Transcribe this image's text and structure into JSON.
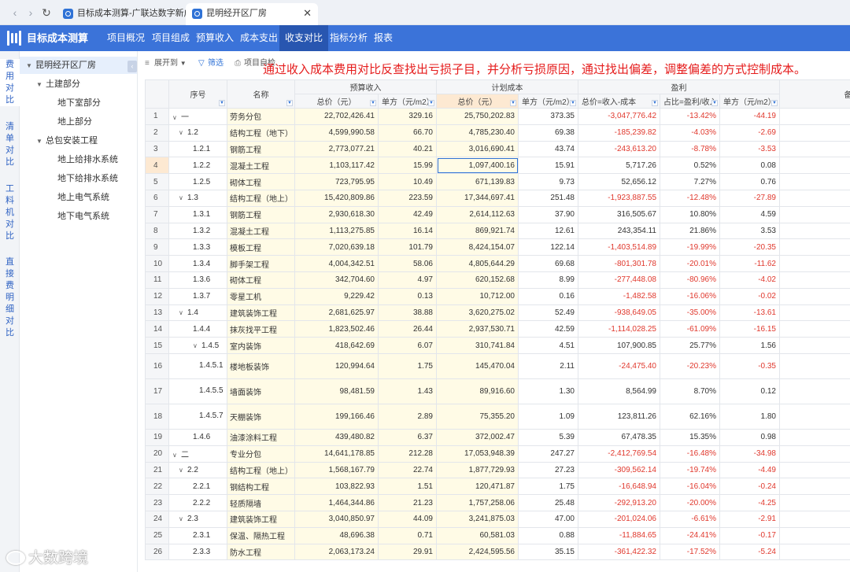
{
  "browser": {
    "tabs": [
      {
        "title": "目标成本测算-广联达数字新成本"
      },
      {
        "title": "昆明经开区厂房"
      }
    ]
  },
  "app": {
    "title": "目标成本测算",
    "menu": [
      "项目概况",
      "项目组成",
      "预算收入",
      "成本支出",
      "收支对比",
      "指标分析",
      "报表"
    ],
    "active_menu": "收支对比"
  },
  "side_tabs": [
    "费用对比",
    "清单对比",
    "工料机对比",
    "直接费明细对比"
  ],
  "tree": [
    {
      "label": "昆明经开区厂房",
      "level": 0,
      "caret": true
    },
    {
      "label": "土建部分",
      "level": 1,
      "caret": true
    },
    {
      "label": "地下室部分",
      "level": 2,
      "caret": false
    },
    {
      "label": "地上部分",
      "level": 2,
      "caret": false
    },
    {
      "label": "总包安装工程",
      "level": 1,
      "caret": true
    },
    {
      "label": "地上给排水系统",
      "level": 2,
      "caret": false
    },
    {
      "label": "地下给排水系统",
      "level": 2,
      "caret": false
    },
    {
      "label": "地上电气系统",
      "level": 2,
      "caret": false
    },
    {
      "label": "地下电气系统",
      "level": 2,
      "caret": false
    }
  ],
  "toolbar": {
    "expand": "展开到",
    "filter": "筛选",
    "check": "项目自检"
  },
  "annotation": "通过收入成本费用对比反查找出亏损子目，并分析亏损原因，通过找出偏差，调整偏差的方式控制成本。",
  "table": {
    "headers": {
      "seq": "序号",
      "name": "名称",
      "budget": "预算收入",
      "plan": "计划成本",
      "profit": "盈利",
      "note": "备注",
      "budget_total": "总价（元）",
      "budget_unit": "单方（元/m2）",
      "plan_total": "总价（元）",
      "plan_unit": "单方（元/m2）",
      "profit_total": "总价=收入-成本",
      "profit_ratio": "占比=盈利/收入",
      "profit_unit": "单方（元/m2）"
    },
    "rows": [
      {
        "idx": "1",
        "seq": "一",
        "caret": true,
        "indent": 0,
        "name": "劳务分包",
        "bt": "22,702,426.41",
        "bu": "329.16",
        "pt": "25,750,202.83",
        "pu": "373.35",
        "ft": "-3,047,776.42",
        "fr": "-13.42%",
        "fu": "-44.19"
      },
      {
        "idx": "2",
        "seq": "1.2",
        "caret": true,
        "indent": 1,
        "name": "结构工程（地下）",
        "bt": "4,599,990.58",
        "bu": "66.70",
        "pt": "4,785,230.40",
        "pu": "69.38",
        "ft": "-185,239.82",
        "fr": "-4.03%",
        "fu": "-2.69"
      },
      {
        "idx": "3",
        "seq": "1.2.1",
        "caret": false,
        "indent": 2,
        "name": "钢筋工程",
        "bt": "2,773,077.21",
        "bu": "40.21",
        "pt": "3,016,690.41",
        "pu": "43.74",
        "ft": "-243,613.20",
        "fr": "-8.78%",
        "fu": "-3.53"
      },
      {
        "idx": "4",
        "seq": "1.2.2",
        "caret": false,
        "indent": 2,
        "name": "混凝土工程",
        "bt": "1,103,117.42",
        "bu": "15.99",
        "pt": "1,097,400.16",
        "pu": "15.91",
        "ft": "5,717.26",
        "fr": "0.52%",
        "fu": "0.08"
      },
      {
        "idx": "5",
        "seq": "1.2.5",
        "caret": false,
        "indent": 2,
        "name": "砌体工程",
        "bt": "723,795.95",
        "bu": "10.49",
        "pt": "671,139.83",
        "pu": "9.73",
        "ft": "52,656.12",
        "fr": "7.27%",
        "fu": "0.76"
      },
      {
        "idx": "6",
        "seq": "1.3",
        "caret": true,
        "indent": 1,
        "name": "结构工程（地上）",
        "bt": "15,420,809.86",
        "bu": "223.59",
        "pt": "17,344,697.41",
        "pu": "251.48",
        "ft": "-1,923,887.55",
        "fr": "-12.48%",
        "fu": "-27.89"
      },
      {
        "idx": "7",
        "seq": "1.3.1",
        "caret": false,
        "indent": 2,
        "name": "钢筋工程",
        "bt": "2,930,618.30",
        "bu": "42.49",
        "pt": "2,614,112.63",
        "pu": "37.90",
        "ft": "316,505.67",
        "fr": "10.80%",
        "fu": "4.59"
      },
      {
        "idx": "8",
        "seq": "1.3.2",
        "caret": false,
        "indent": 2,
        "name": "混凝土工程",
        "bt": "1,113,275.85",
        "bu": "16.14",
        "pt": "869,921.74",
        "pu": "12.61",
        "ft": "243,354.11",
        "fr": "21.86%",
        "fu": "3.53"
      },
      {
        "idx": "9",
        "seq": "1.3.3",
        "caret": false,
        "indent": 2,
        "name": "模板工程",
        "bt": "7,020,639.18",
        "bu": "101.79",
        "pt": "8,424,154.07",
        "pu": "122.14",
        "ft": "-1,403,514.89",
        "fr": "-19.99%",
        "fu": "-20.35"
      },
      {
        "idx": "10",
        "seq": "1.3.4",
        "caret": false,
        "indent": 2,
        "name": "脚手架工程",
        "bt": "4,004,342.51",
        "bu": "58.06",
        "pt": "4,805,644.29",
        "pu": "69.68",
        "ft": "-801,301.78",
        "fr": "-20.01%",
        "fu": "-11.62"
      },
      {
        "idx": "11",
        "seq": "1.3.6",
        "caret": false,
        "indent": 2,
        "name": "砌体工程",
        "bt": "342,704.60",
        "bu": "4.97",
        "pt": "620,152.68",
        "pu": "8.99",
        "ft": "-277,448.08",
        "fr": "-80.96%",
        "fu": "-4.02"
      },
      {
        "idx": "12",
        "seq": "1.3.7",
        "caret": false,
        "indent": 2,
        "name": "零星工机",
        "bt": "9,229.42",
        "bu": "0.13",
        "pt": "10,712.00",
        "pu": "0.16",
        "ft": "-1,482.58",
        "fr": "-16.06%",
        "fu": "-0.02"
      },
      {
        "idx": "13",
        "seq": "1.4",
        "caret": true,
        "indent": 1,
        "name": "建筑装饰工程",
        "bt": "2,681,625.97",
        "bu": "38.88",
        "pt": "3,620,275.02",
        "pu": "52.49",
        "ft": "-938,649.05",
        "fr": "-35.00%",
        "fu": "-13.61"
      },
      {
        "idx": "14",
        "seq": "1.4.4",
        "caret": false,
        "indent": 2,
        "name": "抹灰找平工程",
        "bt": "1,823,502.46",
        "bu": "26.44",
        "pt": "2,937,530.71",
        "pu": "42.59",
        "ft": "-1,114,028.25",
        "fr": "-61.09%",
        "fu": "-16.15"
      },
      {
        "idx": "15",
        "seq": "1.4.5",
        "caret": true,
        "indent": 2,
        "name": "室内装饰",
        "bt": "418,642.69",
        "bu": "6.07",
        "pt": "310,741.84",
        "pu": "4.51",
        "ft": "107,900.85",
        "fr": "25.77%",
        "fu": "1.56"
      },
      {
        "idx": "16",
        "seq": "1.4.5.1",
        "caret": false,
        "indent": 3,
        "tall": true,
        "name": "楼地板装饰",
        "bt": "120,994.64",
        "bu": "1.75",
        "pt": "145,470.04",
        "pu": "2.11",
        "ft": "-24,475.40",
        "fr": "-20.23%",
        "fu": "-0.35"
      },
      {
        "idx": "17",
        "seq": "1.4.5.5",
        "caret": false,
        "indent": 3,
        "tall": true,
        "name": "墙面装饰",
        "bt": "98,481.59",
        "bu": "1.43",
        "pt": "89,916.60",
        "pu": "1.30",
        "ft": "8,564.99",
        "fr": "8.70%",
        "fu": "0.12"
      },
      {
        "idx": "18",
        "seq": "1.4.5.7",
        "caret": false,
        "indent": 3,
        "tall": true,
        "name": "天棚装饰",
        "bt": "199,166.46",
        "bu": "2.89",
        "pt": "75,355.20",
        "pu": "1.09",
        "ft": "123,811.26",
        "fr": "62.16%",
        "fu": "1.80"
      },
      {
        "idx": "19",
        "seq": "1.4.6",
        "caret": false,
        "indent": 2,
        "name": "油漆涂料工程",
        "bt": "439,480.82",
        "bu": "6.37",
        "pt": "372,002.47",
        "pu": "5.39",
        "ft": "67,478.35",
        "fr": "15.35%",
        "fu": "0.98"
      },
      {
        "idx": "20",
        "seq": "二",
        "caret": true,
        "indent": 0,
        "name": "专业分包",
        "bt": "14,641,178.85",
        "bu": "212.28",
        "pt": "17,053,948.39",
        "pu": "247.27",
        "ft": "-2,412,769.54",
        "fr": "-16.48%",
        "fu": "-34.98"
      },
      {
        "idx": "21",
        "seq": "2.2",
        "caret": true,
        "indent": 1,
        "name": "结构工程（地上）",
        "bt": "1,568,167.79",
        "bu": "22.74",
        "pt": "1,877,729.93",
        "pu": "27.23",
        "ft": "-309,562.14",
        "fr": "-19.74%",
        "fu": "-4.49"
      },
      {
        "idx": "22",
        "seq": "2.2.1",
        "caret": false,
        "indent": 2,
        "name": "钢结构工程",
        "bt": "103,822.93",
        "bu": "1.51",
        "pt": "120,471.87",
        "pu": "1.75",
        "ft": "-16,648.94",
        "fr": "-16.04%",
        "fu": "-0.24"
      },
      {
        "idx": "23",
        "seq": "2.2.2",
        "caret": false,
        "indent": 2,
        "name": "轻质隔墙",
        "bt": "1,464,344.86",
        "bu": "21.23",
        "pt": "1,757,258.06",
        "pu": "25.48",
        "ft": "-292,913.20",
        "fr": "-20.00%",
        "fu": "-4.25"
      },
      {
        "idx": "24",
        "seq": "2.3",
        "caret": true,
        "indent": 1,
        "name": "建筑装饰工程",
        "bt": "3,040,850.97",
        "bu": "44.09",
        "pt": "3,241,875.03",
        "pu": "47.00",
        "ft": "-201,024.06",
        "fr": "-6.61%",
        "fu": "-2.91"
      },
      {
        "idx": "25",
        "seq": "2.3.1",
        "caret": false,
        "indent": 2,
        "name": "保温、隔热工程",
        "bt": "48,696.38",
        "bu": "0.71",
        "pt": "60,581.03",
        "pu": "0.88",
        "ft": "-11,884.65",
        "fr": "-24.41%",
        "fu": "-0.17"
      },
      {
        "idx": "26",
        "seq": "2.3.3",
        "caret": false,
        "indent": 2,
        "name": "防水工程",
        "bt": "2,063,173.24",
        "bu": "29.91",
        "pt": "2,424,595.56",
        "pu": "35.15",
        "ft": "-361,422.32",
        "fr": "-17.52%",
        "fu": "-5.24"
      }
    ]
  },
  "watermark": "大数跨境",
  "colors": {
    "accent": "#3b73d9",
    "negative": "#e0382d",
    "annotation": "#e51c1c"
  }
}
